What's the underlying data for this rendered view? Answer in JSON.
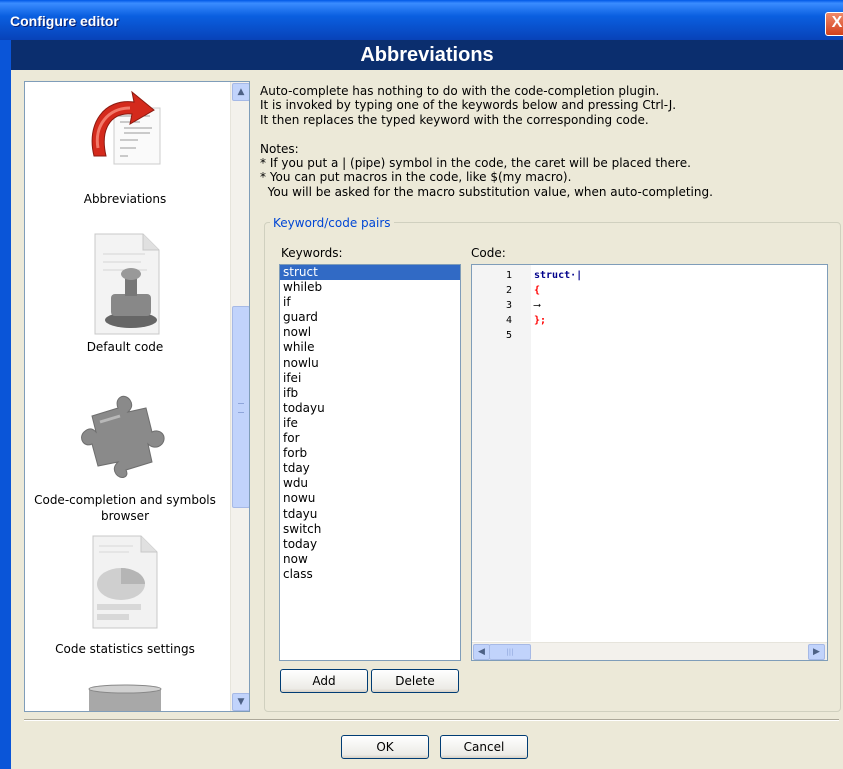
{
  "window": {
    "title": "Configure editor",
    "close_glyph": "X"
  },
  "header": {
    "title": "Abbreviations"
  },
  "sidebar": {
    "items": [
      {
        "label": "Abbreviations",
        "icon": "abbreviations-icon"
      },
      {
        "label": "Default code",
        "icon": "stamp-document-icon"
      },
      {
        "label": "Code-completion and symbols browser",
        "icon": "puzzle-piece-icon"
      },
      {
        "label": "Code statistics settings",
        "icon": "statistics-document-icon"
      }
    ],
    "scroll_up": "▲",
    "scroll_down": "▼"
  },
  "notes": {
    "text": "Auto-complete has nothing to do with the code-completion plugin.\nIt is invoked by typing one of the keywords below and pressing Ctrl-J.\nIt then replaces the typed keyword with the corresponding code.\n\nNotes:\n* If you put a | (pipe) symbol in the code, the caret will be placed there.\n* You can put macros in the code, like $(my macro).\n  You will be asked for the macro substitution value, when auto-completing."
  },
  "group": {
    "title": "Keyword/code pairs"
  },
  "keywords": {
    "label": "Keywords:",
    "selected": "struct",
    "items": [
      "struct",
      "whileb",
      "if",
      "guard",
      "nowl",
      "while",
      "nowlu",
      "ifei",
      "ifb",
      "todayu",
      "ife",
      "for",
      "forb",
      "tday",
      "wdu",
      "nowu",
      "tdayu",
      "switch",
      "today",
      "now",
      "class"
    ]
  },
  "code": {
    "label": "Code:",
    "line_numbers": [
      "1",
      "2",
      "3",
      "4",
      "5"
    ],
    "lines": [
      "struct·|",
      "{",
      "⟶",
      "};",
      ""
    ],
    "colors": {
      "keyword": "#00008b",
      "brace": "#ff0000"
    }
  },
  "buttons": {
    "add": "Add",
    "delete": "Delete",
    "ok": "OK",
    "cancel": "Cancel"
  },
  "scroll_left": "◀",
  "scroll_right": "▶",
  "hscroll_grip": "|||"
}
